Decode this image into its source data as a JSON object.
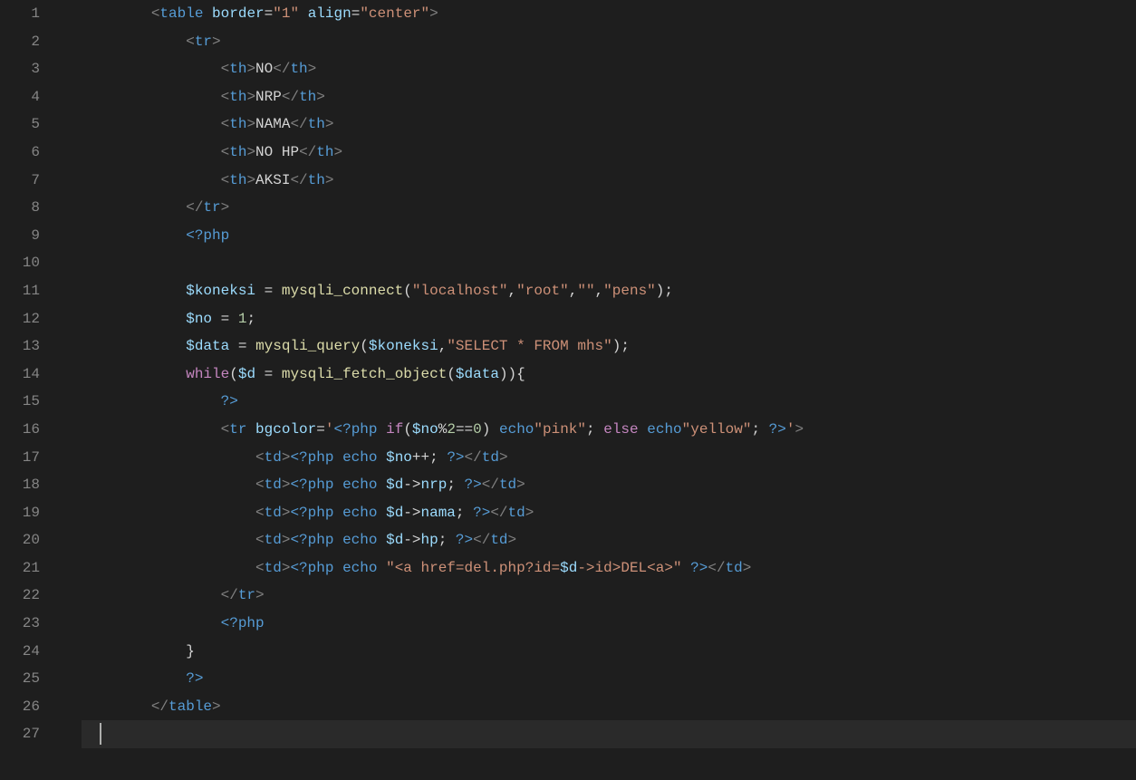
{
  "lineNumbers": [
    "1",
    "2",
    "3",
    "4",
    "5",
    "6",
    "7",
    "8",
    "9",
    "10",
    "11",
    "12",
    "13",
    "14",
    "15",
    "16",
    "17",
    "18",
    "19",
    "20",
    "21",
    "22",
    "23",
    "24",
    "25",
    "26",
    "27"
  ],
  "code": {
    "l1": {
      "indent": "        ",
      "open": "<",
      "tag": "table",
      "sp1": " ",
      "attr1": "border",
      "eq1": "=",
      "val1": "\"1\"",
      "sp2": " ",
      "attr2": "align",
      "eq2": "=",
      "val2": "\"center\"",
      "close": ">"
    },
    "l2": {
      "indent": "            ",
      "open": "<",
      "tag": "tr",
      "close": ">"
    },
    "l3": {
      "indent": "                ",
      "o1": "<",
      "t1": "th",
      "c1": ">",
      "txt": "NO",
      "o2": "</",
      "t2": "th",
      "c2": ">"
    },
    "l4": {
      "indent": "                ",
      "o1": "<",
      "t1": "th",
      "c1": ">",
      "txt": "NRP",
      "o2": "</",
      "t2": "th",
      "c2": ">"
    },
    "l5": {
      "indent": "                ",
      "o1": "<",
      "t1": "th",
      "c1": ">",
      "txt": "NAMA",
      "o2": "</",
      "t2": "th",
      "c2": ">"
    },
    "l6": {
      "indent": "                ",
      "o1": "<",
      "t1": "th",
      "c1": ">",
      "txt": "NO HP",
      "o2": "</",
      "t2": "th",
      "c2": ">"
    },
    "l7": {
      "indent": "                ",
      "o1": "<",
      "t1": "th",
      "c1": ">",
      "txt": "AKSI",
      "o2": "</",
      "t2": "th",
      "c2": ">"
    },
    "l8": {
      "indent": "            ",
      "open": "</",
      "tag": "tr",
      "close": ">"
    },
    "l9": {
      "indent": "            ",
      "php": "<?php"
    },
    "l11": {
      "indent": "            ",
      "v1": "$koneksi",
      "sp1": " ",
      "eq": "=",
      "sp2": " ",
      "fn": "mysqli_connect",
      "po": "(",
      "a1": "\"localhost\"",
      "c1": ",",
      "a2": "\"root\"",
      "c2": ",",
      "a3": "\"\"",
      "c3": ",",
      "a4": "\"pens\"",
      "pc": ")",
      "sc": ";"
    },
    "l12": {
      "indent": "            ",
      "v": "$no",
      "sp1": " ",
      "eq": "=",
      "sp2": " ",
      "n": "1",
      "sc": ";"
    },
    "l13": {
      "indent": "            ",
      "v": "$data",
      "sp1": " ",
      "eq": "=",
      "sp2": " ",
      "fn": "mysqli_query",
      "po": "(",
      "a1": "$koneksi",
      "c1": ",",
      "a2": "\"SELECT * FROM mhs\"",
      "pc": ")",
      "sc": ";"
    },
    "l14": {
      "indent": "            ",
      "kw": "while",
      "po": "(",
      "v1": "$d",
      "sp1": " ",
      "eq": "=",
      "sp2": " ",
      "fn": "mysqli_fetch_object",
      "po2": "(",
      "v2": "$data",
      "pc2": ")",
      "pc": ")",
      "br": "{"
    },
    "l15": {
      "indent": "                ",
      "php": "?>"
    },
    "l16": {
      "indent": "                ",
      "o": "<",
      "tg": "tr",
      "sp": " ",
      "at": "bgcolor",
      "eq": "=",
      "q": "'",
      "php1": "<?php",
      "sp2": " ",
      "kw1": "if",
      "po": "(",
      "v": "$no",
      "mod": "%",
      "n2": "2",
      "ee": "==",
      "n0": "0",
      "pc": ")",
      "sp3": " ",
      "ec1": "echo",
      "s1": "\"pink\"",
      "sc1": ";",
      "sp4": " ",
      "kw2": "else",
      "sp5": " ",
      "ec2": "echo",
      "s2": "\"yellow\"",
      "sc2": ";",
      "sp6": " ",
      "php2": "?>",
      "q2": "'",
      "cl": ">"
    },
    "l17": {
      "indent": "                    ",
      "o1": "<",
      "t1": "td",
      "c1": ">",
      "php1": "<?php",
      "sp": " ",
      "ec": "echo",
      "sp2": " ",
      "v": "$no",
      "pp": "++",
      "sc": ";",
      "sp3": " ",
      "php2": "?>",
      "o2": "</",
      "t2": "td",
      "c2": ">"
    },
    "l18": {
      "indent": "                    ",
      "o1": "<",
      "t1": "td",
      "c1": ">",
      "php1": "<?php",
      "sp": " ",
      "ec": "echo",
      "sp2": " ",
      "v": "$d",
      "ar": "->",
      "p": "nrp",
      "sc": ";",
      "sp3": " ",
      "php2": "?>",
      "o2": "</",
      "t2": "td",
      "c2": ">"
    },
    "l19": {
      "indent": "                    ",
      "o1": "<",
      "t1": "td",
      "c1": ">",
      "php1": "<?php",
      "sp": " ",
      "ec": "echo",
      "sp2": " ",
      "v": "$d",
      "ar": "->",
      "p": "nama",
      "sc": ";",
      "sp3": " ",
      "php2": "?>",
      "o2": "</",
      "t2": "td",
      "c2": ">"
    },
    "l20": {
      "indent": "                    ",
      "o1": "<",
      "t1": "td",
      "c1": ">",
      "php1": "<?php",
      "sp": " ",
      "ec": "echo",
      "sp2": " ",
      "v": "$d",
      "ar": "->",
      "p": "hp",
      "sc": ";",
      "sp3": " ",
      "php2": "?>",
      "o2": "</",
      "t2": "td",
      "c2": ">"
    },
    "l21": {
      "indent": "                    ",
      "o1": "<",
      "t1": "td",
      "c1": ">",
      "php1": "<?php",
      "sp": " ",
      "ec": "echo",
      "sp2": " ",
      "s": "\"<a href=del.php?id=",
      "v": "$d",
      "ar": "->",
      "p": "id",
      "s2": ">DEL<a>\"",
      "sp3": " ",
      "php2": "?>",
      "o2": "</",
      "t2": "td",
      "c2": ">"
    },
    "l22": {
      "indent": "                ",
      "open": "</",
      "tag": "tr",
      "close": ">"
    },
    "l23": {
      "indent": "                ",
      "php": "<?php"
    },
    "l24": {
      "indent": "            ",
      "br": "}"
    },
    "l25": {
      "indent": "            ",
      "php": "?>"
    },
    "l26": {
      "indent": "        ",
      "open": "</",
      "tag": "table",
      "close": ">"
    }
  }
}
